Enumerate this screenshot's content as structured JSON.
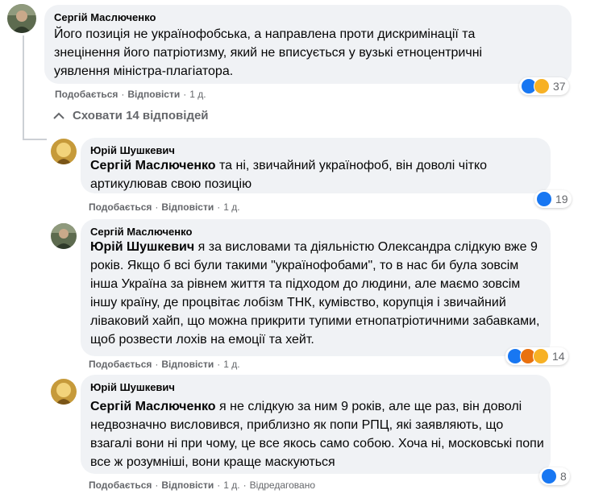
{
  "comment": {
    "author": "Сергій Маслюченко",
    "text": "Його позиція не українофобська, а направлена проти дискримінації та знецінення його патріотизму, який не вписується у вузькі етноцентричні уявлення міністра-плагіатора.",
    "like_label": "Подобається",
    "reply_label": "Відповісти",
    "time": "1 д.",
    "reaction_count": "37",
    "reactions": [
      "like-icon",
      "haha-icon"
    ]
  },
  "toggle": {
    "label": "Сховати 14 відповідей",
    "icon": "chevron-up-icon"
  },
  "replies": [
    {
      "author": "Юрій Шушкевич",
      "mention": "Сергій Маслюченко",
      "text": " та ні, звичайний українофоб, він доволі чітко артикулював свою позицію",
      "like_label": "Подобається",
      "reply_label": "Відповісти",
      "time": "1 д.",
      "reaction_count": "19",
      "reactions": [
        "like-icon"
      ]
    },
    {
      "author": "Сергій Маслюченко",
      "mention": "Юрій Шушкевич",
      "text": " я за висловами та діяльністю Олександра слідкую вже 9 років. Якщо б всі були такими \"українофобами\", то в нас би була зовсім інша Україна за рівнем життя та підходом до людини, але маємо зовсім іншу країну, де процвітає лобізм ТНК, кумівство, корупція і звичайний ліваковий хайп, що можна прикрити тупими етнопатріотичними забавками, щоб розвести лохів на емоції та хейт.",
      "like_label": "Подобається",
      "reply_label": "Відповісти",
      "time": "1 д.",
      "reaction_count": "14",
      "reactions": [
        "like-icon",
        "angry-icon",
        "haha-icon"
      ]
    },
    {
      "author": "Юрій Шушкевич",
      "mention": "Сергій Маслюченко",
      "text": " я не слідкую за ним 9 років, але ще раз, він доволі недвозначно висловився, приблизно як попи РПЦ, які заявляють, що взагалі вони ні при чому, це все якось само собою. Хоча ні, московські попи все ж розумніші, вони краще маскуються",
      "like_label": "Подобається",
      "reply_label": "Відповісти",
      "time": "1 д.",
      "edited_label": "Відредаговано",
      "reaction_count": "8",
      "reactions": [
        "like-icon"
      ]
    }
  ],
  "colors": {
    "bubble": "#f0f2f5",
    "meta": "#65676b",
    "like": "#1877f2",
    "haha": "#f7b125",
    "angry": "#e9710f"
  }
}
